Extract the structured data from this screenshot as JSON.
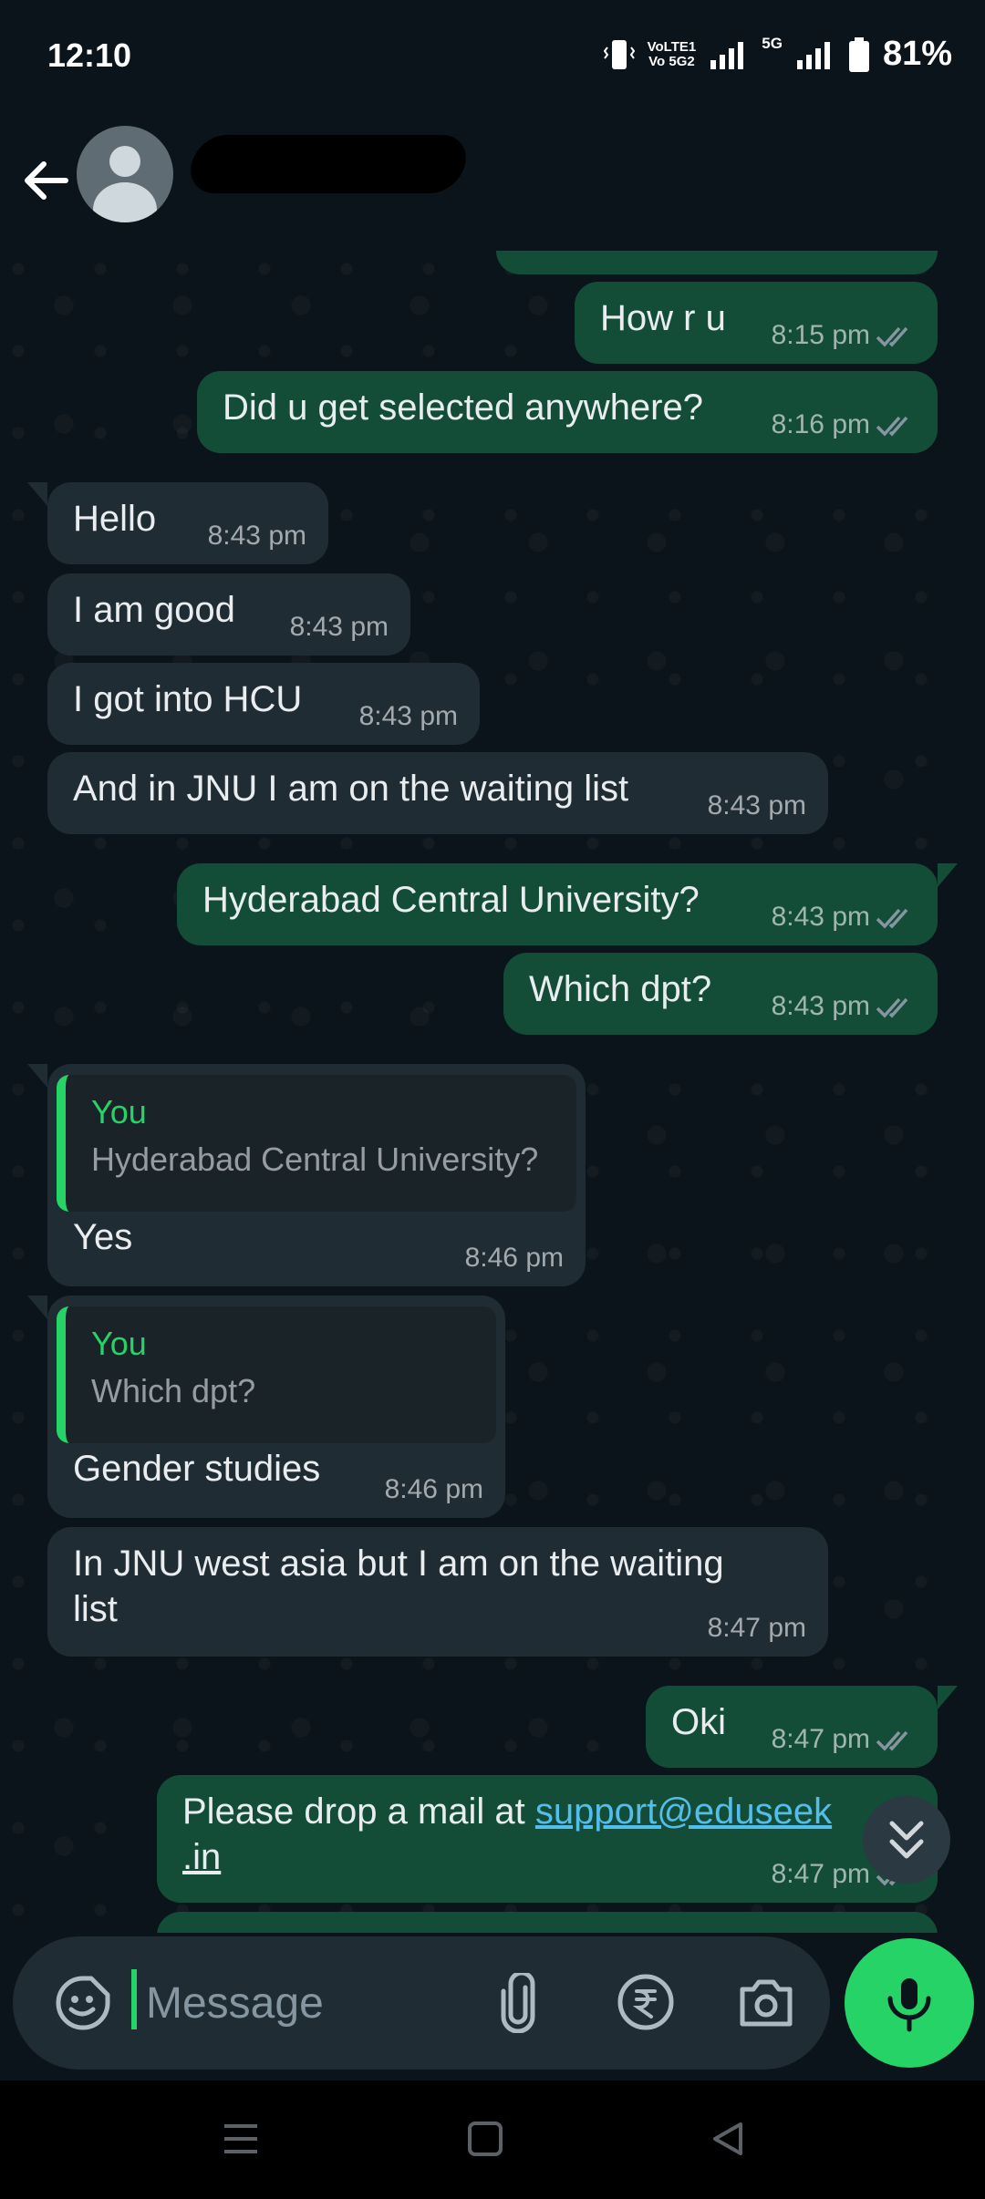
{
  "status_bar": {
    "time": "12:10",
    "network_line1": "VoLTE1",
    "network_line2": "Vo 5G2",
    "net_type": "5G",
    "battery": "81%"
  },
  "header": {
    "contact_name_redacted": true,
    "icons": [
      "back-arrow-icon",
      "avatar",
      "video-call-icon",
      "voice-call-icon",
      "more-options-icon"
    ]
  },
  "messages": [
    {
      "direction": "out",
      "text": "How r u",
      "time": "8:15 pm",
      "read": true
    },
    {
      "direction": "out",
      "text": "Did u get selected anywhere?",
      "time": "8:16 pm",
      "read": true
    },
    {
      "direction": "in",
      "text": "Hello",
      "time": "8:43 pm"
    },
    {
      "direction": "in",
      "text": "I am good",
      "time": "8:43 pm"
    },
    {
      "direction": "in",
      "text": "I got into HCU",
      "time": "8:43 pm"
    },
    {
      "direction": "in",
      "text": "And in JNU I am on the waiting list",
      "time": "8:43 pm"
    },
    {
      "direction": "out",
      "text": "Hyderabad Central University?",
      "time": "8:43 pm",
      "read": true
    },
    {
      "direction": "out",
      "text": "Which dpt?",
      "time": "8:43 pm",
      "read": true
    },
    {
      "direction": "in",
      "quote_author": "You",
      "quote_text": "Hyderabad Central University?",
      "text": "Yes",
      "time": "8:46 pm"
    },
    {
      "direction": "in",
      "quote_author": "You",
      "quote_text": "Which dpt?",
      "text": "Gender studies",
      "time": "8:46 pm"
    },
    {
      "direction": "in",
      "text_line1": "In JNU west asia but I am on the waiting",
      "text_line2": "list",
      "time": "8:47 pm"
    },
    {
      "direction": "out",
      "text": "Oki",
      "time": "8:47 pm",
      "read": true
    },
    {
      "direction": "out",
      "text_prefix": "Please drop a mail at ",
      "link_line1": "support@eduseek",
      "link_line2": ".in",
      "time": "8:47 pm",
      "read": true
    }
  ],
  "composer": {
    "placeholder": "Message",
    "icons": [
      "emoji-sticker-icon",
      "attach-icon",
      "rupee-payment-icon",
      "camera-icon",
      "mic-icon"
    ]
  },
  "colors": {
    "background": "#0b141a",
    "outgoing_bubble": "#144d37",
    "incoming_bubble": "#202c33",
    "accent": "#25d366",
    "link": "#53bdeb",
    "read_ticks": "#8696a0"
  }
}
